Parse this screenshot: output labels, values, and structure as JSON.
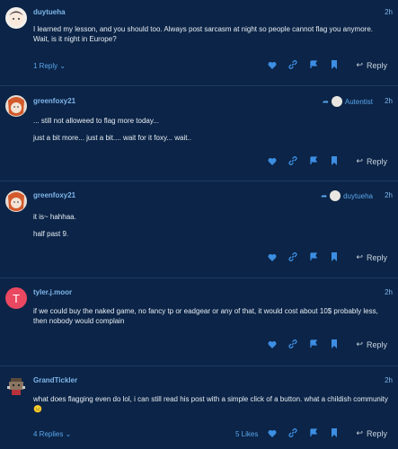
{
  "posts": [
    {
      "username": "duytueha",
      "time": "2h",
      "lines": [
        "I learned my lesson, and you should too. Always post sarcasm at night so people cannot flag you anymore. Wait, is it night in Europe?"
      ],
      "replies_label": "1 Reply",
      "reply_label": "Reply"
    },
    {
      "username": "greenfoxy21",
      "time": "2h",
      "reply_to": "Autentist",
      "lines": [
        "... still not alloweed to flag more today...",
        "just a bit more... just a bit.... wait for it foxy... wait.."
      ],
      "reply_label": "Reply"
    },
    {
      "username": "greenfoxy21",
      "time": "2h",
      "reply_to": "duytueha",
      "lines": [
        "it is~ hahhaa.",
        "half past 9."
      ],
      "reply_label": "Reply"
    },
    {
      "username": "tyler.j.moor",
      "time": "2h",
      "avatar_letter": "T",
      "lines": [
        "if we could buy the naked game, no fancy tp or eadgear or any of that, it would cost about 10$ probably less, then nobody would complain"
      ],
      "reply_label": "Reply"
    },
    {
      "username": "GrandTickler",
      "time": "2h",
      "lines": [
        "what does flagging even do lol, i can still read his post with a simple click of a button. what a childish community 😑"
      ],
      "replies_label": "4 Replies",
      "likes_label": "5 Likes",
      "reply_label": "Reply"
    }
  ],
  "colors": {
    "background": "#0b2447",
    "accent": "#3d8ee2",
    "username": "#7fb6ea"
  }
}
